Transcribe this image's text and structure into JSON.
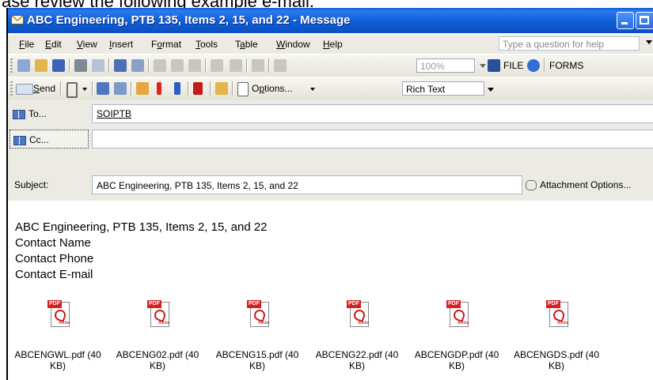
{
  "caption": "ase review the following example e-mail.",
  "window": {
    "title": "ABC Engineering, PTB 135, Items 2, 15, and 22 - Message"
  },
  "menu": {
    "items": [
      {
        "pre": "",
        "ul": "F",
        "post": "ile"
      },
      {
        "pre": "",
        "ul": "E",
        "post": "dit"
      },
      {
        "pre": "",
        "ul": "V",
        "post": "iew"
      },
      {
        "pre": "",
        "ul": "I",
        "post": "nsert"
      },
      {
        "pre": "F",
        "ul": "o",
        "post": "rmat"
      },
      {
        "pre": "",
        "ul": "T",
        "post": "ools"
      },
      {
        "pre": "T",
        "ul": "a",
        "post": "ble"
      },
      {
        "pre": "",
        "ul": "W",
        "post": "indow"
      },
      {
        "pre": "",
        "ul": "H",
        "post": "elp"
      }
    ],
    "help_placeholder": "Type a question for help"
  },
  "toolbar1": {
    "zoom": "100%",
    "file_label": "FILE",
    "forms_label": "FORMS"
  },
  "toolbar2": {
    "send_ul": "S",
    "send_rest": "end",
    "options_pre": "O",
    "options_ul": "p",
    "options_rest": "tions...",
    "format": "Rich Text"
  },
  "header": {
    "to_label": "To...",
    "to_value": "SOIPTB",
    "cc_label": "Cc...",
    "cc_value": "",
    "subject_label": "Subject:",
    "subject_value": "ABC Engineering, PTB 135, Items 2, 15, and 22",
    "attachment_options": "Attachment Options..."
  },
  "body": {
    "lines": [
      "ABC Engineering, PTB 135, Items 2, 15, and 22",
      "Contact Name",
      "Contact Phone",
      "Contact E-mail"
    ]
  },
  "attachments": [
    {
      "line1": "ABCENGWL.pdf (40",
      "line2": "KB)"
    },
    {
      "line1": "ABCENG02.pdf (40",
      "line2": "KB)"
    },
    {
      "line1": "ABCENG15.pdf (40",
      "line2": "KB)"
    },
    {
      "line1": "ABCENG22.pdf (40",
      "line2": "KB)"
    },
    {
      "line1": "ABCENGDP.pdf (40",
      "line2": "KB)"
    },
    {
      "line1": "ABCENGDS.pdf (40",
      "line2": "KB)"
    }
  ],
  "pdf_tag": "PDF",
  "pdf_brand": "Adobe",
  "colors": {
    "titlebar": "#0f5ed6",
    "chrome": "#ecebe3",
    "pdf_red": "#d61f1f"
  }
}
